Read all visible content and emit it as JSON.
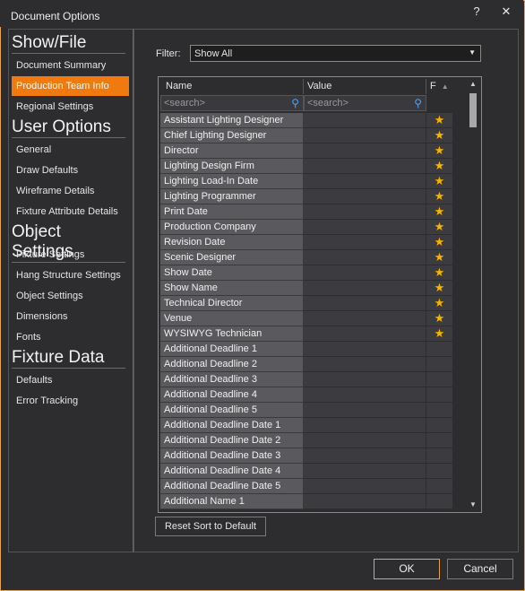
{
  "window": {
    "title": "Document Options",
    "help_label": "?",
    "close_label": "✕"
  },
  "sidebar": {
    "sections": [
      {
        "header": "Show/File",
        "items": [
          "Document Summary",
          "Production Team Info",
          "Regional Settings"
        ]
      },
      {
        "header": "User Options",
        "items": [
          "General",
          "Draw Defaults",
          "Wireframe Details",
          "Fixture Attribute Details"
        ]
      },
      {
        "header": "Object Settings",
        "items": [
          "Fixture Settings",
          "Hang Structure Settings",
          "Object Settings",
          "Dimensions",
          "Fonts"
        ]
      },
      {
        "header": "Fixture Data",
        "items": [
          "Defaults",
          "Error Tracking"
        ]
      }
    ],
    "active_item": "Production Team Info"
  },
  "filter": {
    "label": "Filter:",
    "value": "Show All"
  },
  "table": {
    "columns": {
      "name": "Name",
      "value": "Value",
      "fav": "F"
    },
    "search_placeholder": "<search>",
    "rows": [
      {
        "name": "Assistant Lighting Designer",
        "value": "",
        "favorite": true
      },
      {
        "name": "Chief Lighting Designer",
        "value": "",
        "favorite": true
      },
      {
        "name": "Director",
        "value": "",
        "favorite": true
      },
      {
        "name": "Lighting Design Firm",
        "value": "",
        "favorite": true
      },
      {
        "name": "Lighting Load-In Date",
        "value": "",
        "favorite": true
      },
      {
        "name": "Lighting Programmer",
        "value": "",
        "favorite": true
      },
      {
        "name": "Print Date",
        "value": "",
        "favorite": true
      },
      {
        "name": "Production Company",
        "value": "",
        "favorite": true
      },
      {
        "name": "Revision Date",
        "value": "",
        "favorite": true
      },
      {
        "name": "Scenic Designer",
        "value": "",
        "favorite": true
      },
      {
        "name": "Show Date",
        "value": "",
        "favorite": true
      },
      {
        "name": "Show Name",
        "value": "",
        "favorite": true
      },
      {
        "name": "Technical Director",
        "value": "",
        "favorite": true
      },
      {
        "name": "Venue",
        "value": "",
        "favorite": true
      },
      {
        "name": "WYSIWYG Technician",
        "value": "",
        "favorite": true
      },
      {
        "name": "Additional Deadline 1",
        "value": "",
        "favorite": false
      },
      {
        "name": "Additional Deadline 2",
        "value": "",
        "favorite": false
      },
      {
        "name": "Additional Deadline 3",
        "value": "",
        "favorite": false
      },
      {
        "name": "Additional Deadline 4",
        "value": "",
        "favorite": false
      },
      {
        "name": "Additional Deadline 5",
        "value": "",
        "favorite": false
      },
      {
        "name": "Additional Deadline Date 1",
        "value": "",
        "favorite": false
      },
      {
        "name": "Additional Deadline Date 2",
        "value": "",
        "favorite": false
      },
      {
        "name": "Additional Deadline Date 3",
        "value": "",
        "favorite": false
      },
      {
        "name": "Additional Deadline Date 4",
        "value": "",
        "favorite": false
      },
      {
        "name": "Additional Deadline Date 5",
        "value": "",
        "favorite": false
      },
      {
        "name": "Additional Name 1",
        "value": "",
        "favorite": false
      }
    ]
  },
  "buttons": {
    "reset_sort": "Reset Sort to Default",
    "ok": "OK",
    "cancel": "Cancel"
  },
  "colors": {
    "accent": "#f07a10",
    "focus_border": "#e8a24a",
    "star": "#f4b400"
  }
}
